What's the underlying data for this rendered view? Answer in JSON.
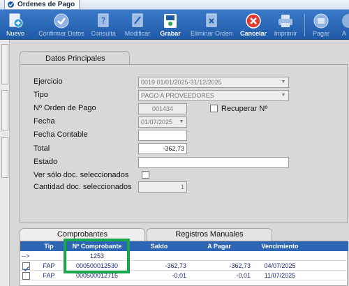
{
  "window": {
    "title": "Ordenes de Pago"
  },
  "toolbar": {
    "nuevo": "Nuevo",
    "confirmar": "Confirmar Datos",
    "consulta": "Consulta",
    "modificar": "Modificar",
    "grabar": "Grabar",
    "eliminar": "Eliminar Orden",
    "cancelar": "Cancelar",
    "imprimir": "Imprimir",
    "pagar": "Pagar",
    "extra": "A"
  },
  "main_tab": {
    "label": "Datos Principales"
  },
  "form": {
    "ejercicio_label": "Ejercicio",
    "ejercicio_value": "0019 01/01/2025-31/12/2025",
    "tipo_label": "Tipo",
    "tipo_value": "PAGO A PROVEEDORES",
    "orden_label": "Nº Orden de Pago",
    "orden_value": "001434",
    "recuperar_label": "Recuperar Nº",
    "fecha_label": "Fecha",
    "fecha_value": "01/07/2025",
    "fecha_contable_label": "Fecha Contable",
    "fecha_contable_value": "",
    "total_label": "Total",
    "total_value": "-362,73",
    "estado_label": "Estado",
    "estado_value": "",
    "ver_solo_label": "Ver sólo doc. seleccionados",
    "cantidad_label": "Cantidad doc. seleccionados",
    "cantidad_value": "1"
  },
  "bottom_tabs": {
    "comprobantes": "Comprobantes",
    "registros": "Registros Manuales"
  },
  "grid": {
    "headers": {
      "tip": "Tip",
      "comprobante": "Nº Comprobante",
      "saldo": "Saldo",
      "apagar": "A Pagar",
      "vencimiento": "Vencimiento"
    },
    "rows": [
      {
        "marker": "-->",
        "tip": "",
        "comprobante": "1253",
        "saldo": "",
        "apagar": "",
        "vencimiento": ""
      },
      {
        "marker": "",
        "tip": "FAP",
        "comprobante": "000500012530",
        "saldo": "-362,73",
        "apagar": "-362,73",
        "vencimiento": "04/07/2025"
      },
      {
        "marker": "",
        "tip": "FAP",
        "comprobante": "000500012716",
        "saldo": "-0,01",
        "apagar": "-0,01",
        "vencimiento": "11/07/2025"
      }
    ]
  },
  "colors": {
    "toolbar": "#2a6bbd",
    "grid_header": "#2d66b5",
    "highlight": "#1aa64a"
  }
}
